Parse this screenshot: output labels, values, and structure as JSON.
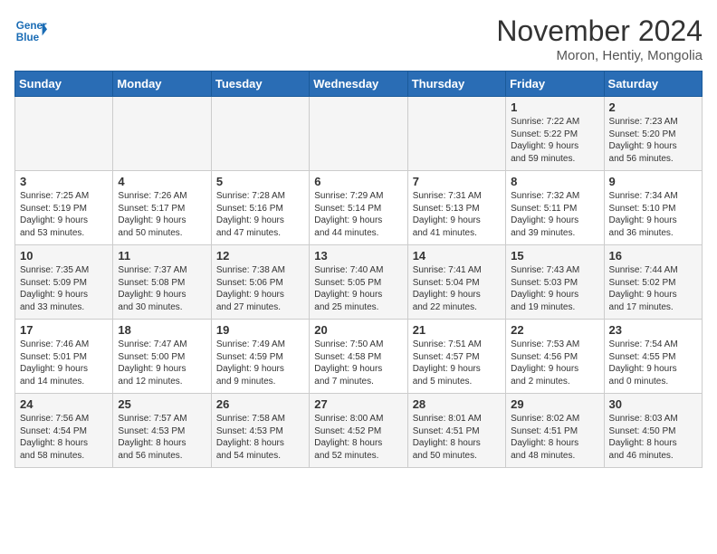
{
  "header": {
    "logo_line1": "General",
    "logo_line2": "Blue",
    "month": "November 2024",
    "location": "Moron, Hentiy, Mongolia"
  },
  "days_of_week": [
    "Sunday",
    "Monday",
    "Tuesday",
    "Wednesday",
    "Thursday",
    "Friday",
    "Saturday"
  ],
  "weeks": [
    [
      {
        "day": "",
        "info": ""
      },
      {
        "day": "",
        "info": ""
      },
      {
        "day": "",
        "info": ""
      },
      {
        "day": "",
        "info": ""
      },
      {
        "day": "",
        "info": ""
      },
      {
        "day": "1",
        "info": "Sunrise: 7:22 AM\nSunset: 5:22 PM\nDaylight: 9 hours\nand 59 minutes."
      },
      {
        "day": "2",
        "info": "Sunrise: 7:23 AM\nSunset: 5:20 PM\nDaylight: 9 hours\nand 56 minutes."
      }
    ],
    [
      {
        "day": "3",
        "info": "Sunrise: 7:25 AM\nSunset: 5:19 PM\nDaylight: 9 hours\nand 53 minutes."
      },
      {
        "day": "4",
        "info": "Sunrise: 7:26 AM\nSunset: 5:17 PM\nDaylight: 9 hours\nand 50 minutes."
      },
      {
        "day": "5",
        "info": "Sunrise: 7:28 AM\nSunset: 5:16 PM\nDaylight: 9 hours\nand 47 minutes."
      },
      {
        "day": "6",
        "info": "Sunrise: 7:29 AM\nSunset: 5:14 PM\nDaylight: 9 hours\nand 44 minutes."
      },
      {
        "day": "7",
        "info": "Sunrise: 7:31 AM\nSunset: 5:13 PM\nDaylight: 9 hours\nand 41 minutes."
      },
      {
        "day": "8",
        "info": "Sunrise: 7:32 AM\nSunset: 5:11 PM\nDaylight: 9 hours\nand 39 minutes."
      },
      {
        "day": "9",
        "info": "Sunrise: 7:34 AM\nSunset: 5:10 PM\nDaylight: 9 hours\nand 36 minutes."
      }
    ],
    [
      {
        "day": "10",
        "info": "Sunrise: 7:35 AM\nSunset: 5:09 PM\nDaylight: 9 hours\nand 33 minutes."
      },
      {
        "day": "11",
        "info": "Sunrise: 7:37 AM\nSunset: 5:08 PM\nDaylight: 9 hours\nand 30 minutes."
      },
      {
        "day": "12",
        "info": "Sunrise: 7:38 AM\nSunset: 5:06 PM\nDaylight: 9 hours\nand 27 minutes."
      },
      {
        "day": "13",
        "info": "Sunrise: 7:40 AM\nSunset: 5:05 PM\nDaylight: 9 hours\nand 25 minutes."
      },
      {
        "day": "14",
        "info": "Sunrise: 7:41 AM\nSunset: 5:04 PM\nDaylight: 9 hours\nand 22 minutes."
      },
      {
        "day": "15",
        "info": "Sunrise: 7:43 AM\nSunset: 5:03 PM\nDaylight: 9 hours\nand 19 minutes."
      },
      {
        "day": "16",
        "info": "Sunrise: 7:44 AM\nSunset: 5:02 PM\nDaylight: 9 hours\nand 17 minutes."
      }
    ],
    [
      {
        "day": "17",
        "info": "Sunrise: 7:46 AM\nSunset: 5:01 PM\nDaylight: 9 hours\nand 14 minutes."
      },
      {
        "day": "18",
        "info": "Sunrise: 7:47 AM\nSunset: 5:00 PM\nDaylight: 9 hours\nand 12 minutes."
      },
      {
        "day": "19",
        "info": "Sunrise: 7:49 AM\nSunset: 4:59 PM\nDaylight: 9 hours\nand 9 minutes."
      },
      {
        "day": "20",
        "info": "Sunrise: 7:50 AM\nSunset: 4:58 PM\nDaylight: 9 hours\nand 7 minutes."
      },
      {
        "day": "21",
        "info": "Sunrise: 7:51 AM\nSunset: 4:57 PM\nDaylight: 9 hours\nand 5 minutes."
      },
      {
        "day": "22",
        "info": "Sunrise: 7:53 AM\nSunset: 4:56 PM\nDaylight: 9 hours\nand 2 minutes."
      },
      {
        "day": "23",
        "info": "Sunrise: 7:54 AM\nSunset: 4:55 PM\nDaylight: 9 hours\nand 0 minutes."
      }
    ],
    [
      {
        "day": "24",
        "info": "Sunrise: 7:56 AM\nSunset: 4:54 PM\nDaylight: 8 hours\nand 58 minutes."
      },
      {
        "day": "25",
        "info": "Sunrise: 7:57 AM\nSunset: 4:53 PM\nDaylight: 8 hours\nand 56 minutes."
      },
      {
        "day": "26",
        "info": "Sunrise: 7:58 AM\nSunset: 4:53 PM\nDaylight: 8 hours\nand 54 minutes."
      },
      {
        "day": "27",
        "info": "Sunrise: 8:00 AM\nSunset: 4:52 PM\nDaylight: 8 hours\nand 52 minutes."
      },
      {
        "day": "28",
        "info": "Sunrise: 8:01 AM\nSunset: 4:51 PM\nDaylight: 8 hours\nand 50 minutes."
      },
      {
        "day": "29",
        "info": "Sunrise: 8:02 AM\nSunset: 4:51 PM\nDaylight: 8 hours\nand 48 minutes."
      },
      {
        "day": "30",
        "info": "Sunrise: 8:03 AM\nSunset: 4:50 PM\nDaylight: 8 hours\nand 46 minutes."
      }
    ]
  ]
}
